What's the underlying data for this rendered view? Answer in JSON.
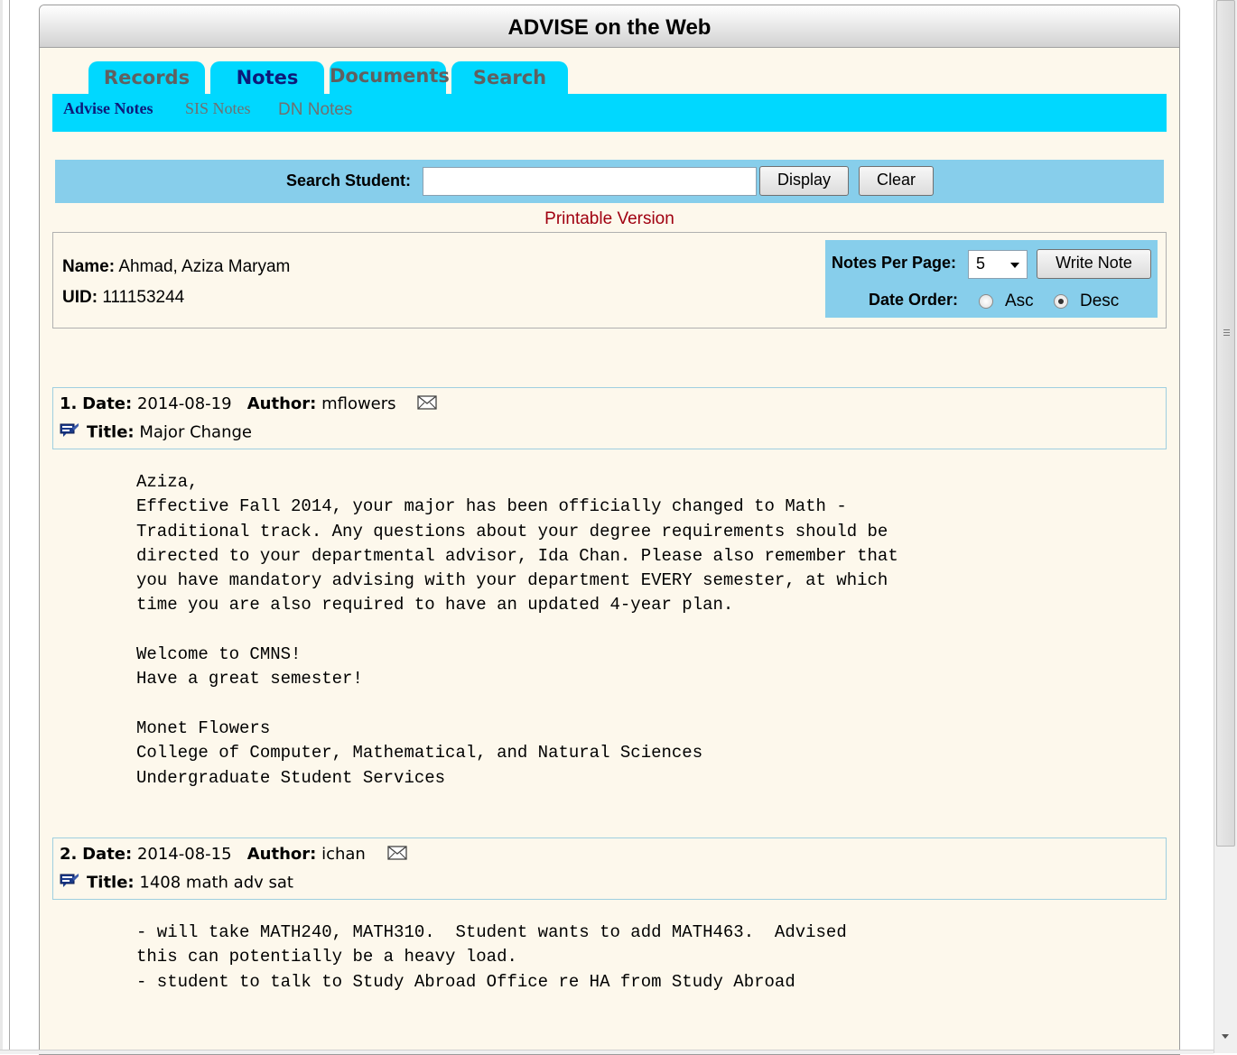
{
  "app": {
    "title": "ADVISE on the Web"
  },
  "tabs": [
    {
      "label": "Records",
      "active": false
    },
    {
      "label": "Notes",
      "active": true
    },
    {
      "label": "Documents",
      "active": false
    },
    {
      "label": "Search",
      "active": false
    }
  ],
  "subnav": [
    {
      "label": "Advise Notes",
      "active": true
    },
    {
      "label": "SIS Notes",
      "active": false
    },
    {
      "label": "DN Notes",
      "active": false
    }
  ],
  "search": {
    "label": "Search Student:",
    "value": "",
    "placeholder": "",
    "display_label": "Display",
    "clear_label": "Clear"
  },
  "printable_label": "Printable Version",
  "student": {
    "name_label": "Name:",
    "name": "Ahmad, Aziza Maryam",
    "uid_label": "UID:",
    "uid": "111153244"
  },
  "controls": {
    "per_page_label": "Notes Per Page:",
    "per_page_value": "5",
    "write_note_label": "Write Note",
    "date_order_label": "Date Order:",
    "asc_label": "Asc",
    "desc_label": "Desc",
    "selected_order": "Desc"
  },
  "notes": [
    {
      "number": "1.",
      "date_label": "Date:",
      "date": "2014-08-19",
      "author_label": "Author:",
      "author": "mflowers",
      "title_label": "Title:",
      "title": "Major Change",
      "body": "Aziza,\nEffective Fall 2014, your major has been officially changed to Math -\nTraditional track. Any questions about your degree requirements should be\ndirected to your departmental advisor, Ida Chan. Please also remember that\nyou have mandatory advising with your department EVERY semester, at which\ntime you are also required to have an updated 4-year plan.\n\nWelcome to CMNS!\nHave a great semester!\n\nMonet Flowers\nCollege of Computer, Mathematical, and Natural Sciences\nUndergraduate Student Services"
    },
    {
      "number": "2.",
      "date_label": "Date:",
      "date": "2014-08-15",
      "author_label": "Author:",
      "author": "ichan",
      "title_label": "Title:",
      "title": "1408 math adv sat",
      "body": "- will take MATH240, MATH310.  Student wants to add MATH463.  Advised\nthis can potentially be a heavy load.\n- student to talk to Study Abroad Office re HA from Study Abroad"
    }
  ],
  "colors": {
    "tab_bg": "#00d8ff",
    "active_text": "#0d1a7a",
    "search_bar_bg": "#87ceeb",
    "panel_bg": "#fdf8ec",
    "printable_link": "#a00010"
  }
}
